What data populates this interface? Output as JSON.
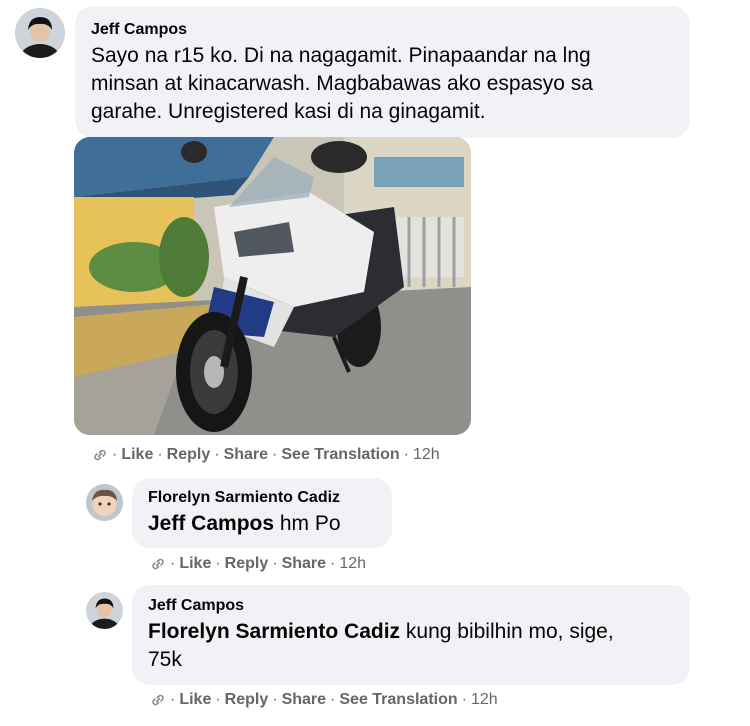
{
  "comments": [
    {
      "author": "Jeff Campos",
      "mention": "",
      "text_lines": [
        "Sayo na r15 ko. Di na nagagamit. Pinapaandar na lng",
        "minsan at kinacarwash. Magbabawas ako espasyo sa",
        "garahe. Unregistered kasi di na ginagamit."
      ],
      "actions": {
        "like": "Like",
        "reply": "Reply",
        "share": "Share",
        "translate": "See Translation",
        "time": "12h"
      }
    },
    {
      "author": "Florelyn Sarmiento Cadiz",
      "mention": "Jeff Campos",
      "text": "hm Po",
      "actions": {
        "like": "Like",
        "reply": "Reply",
        "share": "Share",
        "time": "12h"
      }
    },
    {
      "author": "Jeff Campos",
      "mention": "Florelyn Sarmiento Cadiz",
      "text_line1": "kung bibilhin mo, sige,",
      "text_line2": "75k",
      "actions": {
        "like": "Like",
        "reply": "Reply",
        "share": "Share",
        "translate": "See Translation",
        "time": "12h"
      }
    }
  ],
  "separator": "·",
  "colors": {
    "bubble": "#f0f2f5",
    "meta": "#65676b",
    "text": "#050505"
  }
}
